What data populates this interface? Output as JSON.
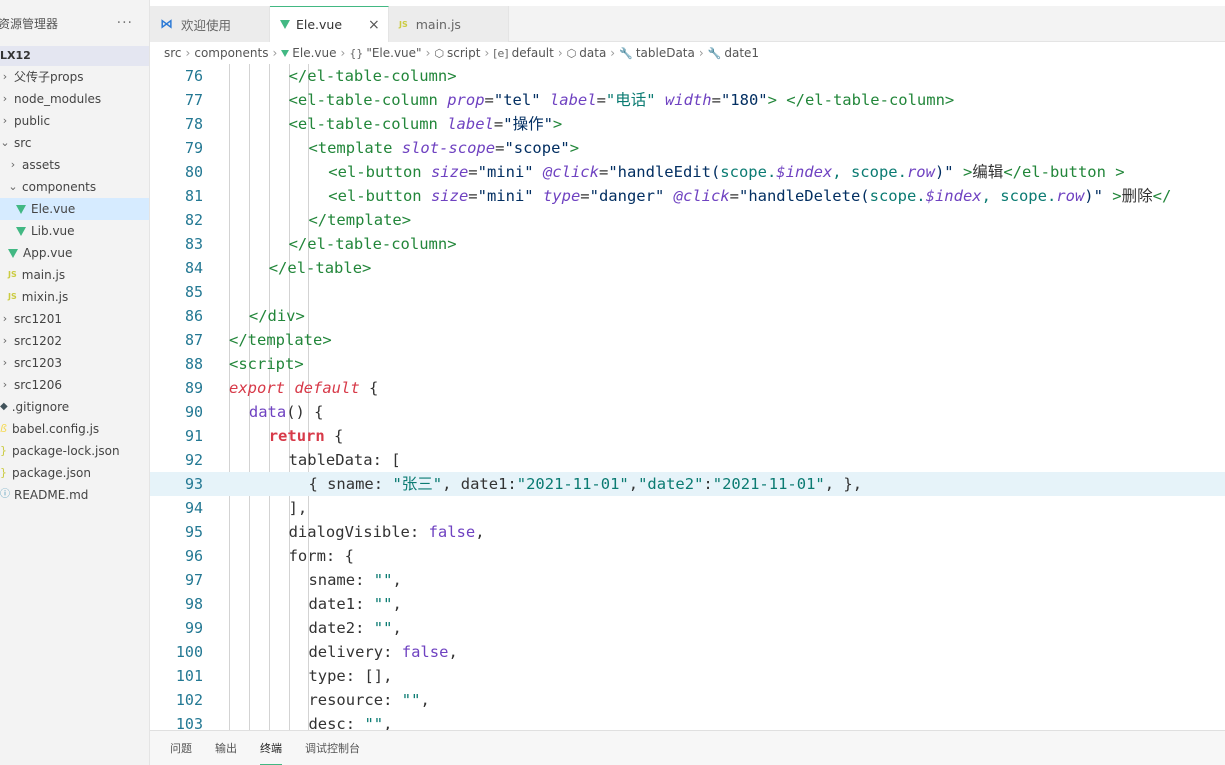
{
  "sidebar": {
    "title": "资源管理器",
    "more": "···",
    "project": "LX12",
    "items": [
      {
        "label": "父传子props",
        "chev": "›",
        "indent": 0,
        "icon": ""
      },
      {
        "label": "node_modules",
        "chev": "›",
        "indent": 0,
        "icon": ""
      },
      {
        "label": "public",
        "chev": "›",
        "indent": 0,
        "icon": ""
      },
      {
        "label": "src",
        "chev": "⌄",
        "indent": 0,
        "icon": ""
      },
      {
        "label": "assets",
        "chev": "›",
        "indent": 1,
        "icon": ""
      },
      {
        "label": "components",
        "chev": "⌄",
        "indent": 1,
        "icon": ""
      },
      {
        "label": "Ele.vue",
        "chev": "",
        "indent": 2,
        "icon": "vue"
      },
      {
        "label": "Lib.vue",
        "chev": "",
        "indent": 2,
        "icon": "vue"
      },
      {
        "label": "App.vue",
        "chev": "",
        "indent": 1,
        "icon": "vue"
      },
      {
        "label": "main.js",
        "chev": "",
        "indent": 1,
        "icon": "js"
      },
      {
        "label": "mixin.js",
        "chev": "",
        "indent": 1,
        "icon": "js"
      },
      {
        "label": "src1201",
        "chev": "›",
        "indent": 0,
        "icon": ""
      },
      {
        "label": "src1202",
        "chev": "›",
        "indent": 0,
        "icon": ""
      },
      {
        "label": "src1203",
        "chev": "›",
        "indent": 0,
        "icon": ""
      },
      {
        "label": "src1206",
        "chev": "›",
        "indent": 0,
        "icon": ""
      },
      {
        "label": ".gitignore",
        "chev": "",
        "indent": 0,
        "icon": "git"
      },
      {
        "label": "babel.config.js",
        "chev": "",
        "indent": 0,
        "icon": "babel"
      },
      {
        "label": "package-lock.json",
        "chev": "",
        "indent": 0,
        "icon": "json"
      },
      {
        "label": "package.json",
        "chev": "",
        "indent": 0,
        "icon": "json"
      },
      {
        "label": "README.md",
        "chev": "",
        "indent": 0,
        "icon": "info"
      }
    ]
  },
  "tabs": [
    {
      "label": "欢迎使用",
      "icon": "vscode-icon",
      "active": false
    },
    {
      "label": "Ele.vue",
      "icon": "vue-icon",
      "active": true,
      "close": "×"
    },
    {
      "label": "main.js",
      "icon": "js-icon",
      "active": false
    }
  ],
  "breadcrumb": [
    {
      "label": "src",
      "icon": ""
    },
    {
      "label": "components",
      "icon": ""
    },
    {
      "label": "Ele.vue",
      "icon": "vue"
    },
    {
      "label": "\"Ele.vue\"",
      "icon": "{}"
    },
    {
      "label": "script",
      "icon": "⬡"
    },
    {
      "label": "default",
      "icon": "[e]"
    },
    {
      "label": "data",
      "icon": "⬡"
    },
    {
      "label": "tableData",
      "icon": "🔧"
    },
    {
      "label": "date1",
      "icon": "🔧"
    }
  ],
  "editor": {
    "current_line": 93,
    "lines": [
      {
        "n": "76",
        "indent": 3,
        "parts": [
          [
            "tag",
            "</el-table-column>"
          ]
        ]
      },
      {
        "n": "77",
        "indent": 3,
        "parts": [
          [
            "tag",
            "<el-table-column "
          ],
          [
            "attr",
            "prop"
          ],
          [
            "punc",
            "="
          ],
          [
            "str",
            "\"tel\""
          ],
          [
            "punc",
            " "
          ],
          [
            "attr",
            "label"
          ],
          [
            "punc",
            "="
          ],
          [
            "str2",
            "\"电话\""
          ],
          [
            "punc",
            " "
          ],
          [
            "attr",
            "width"
          ],
          [
            "punc",
            "="
          ],
          [
            "str",
            "\"180\""
          ],
          [
            "tag",
            "> </el-table-column>"
          ]
        ]
      },
      {
        "n": "78",
        "indent": 3,
        "parts": [
          [
            "tag",
            "<el-table-column "
          ],
          [
            "attr",
            "label"
          ],
          [
            "punc",
            "="
          ],
          [
            "str",
            "\"操作\""
          ],
          [
            "tag",
            ">"
          ]
        ]
      },
      {
        "n": "79",
        "indent": 4,
        "parts": [
          [
            "tag",
            "<template "
          ],
          [
            "attr",
            "slot-scope"
          ],
          [
            "punc",
            "="
          ],
          [
            "str",
            "\"scope\""
          ],
          [
            "tag",
            ">"
          ]
        ]
      },
      {
        "n": "80",
        "indent": 5,
        "parts": [
          [
            "tag",
            "<el-button "
          ],
          [
            "attr",
            "size"
          ],
          [
            "punc",
            "="
          ],
          [
            "str",
            "\"mini\""
          ],
          [
            "punc",
            " "
          ],
          [
            "attr",
            "@click"
          ],
          [
            "punc",
            "="
          ],
          [
            "str",
            "\"handleEdit("
          ],
          [
            "str2",
            "scope."
          ],
          [
            "vattr",
            "$index"
          ],
          [
            "str2",
            ", scope."
          ],
          [
            "vattr",
            "row"
          ],
          [
            "str",
            ")\""
          ],
          [
            "tag",
            " >"
          ],
          [
            "punc",
            "编辑"
          ],
          [
            "tag",
            "</el-button >"
          ]
        ]
      },
      {
        "n": "81",
        "indent": 5,
        "parts": [
          [
            "tag",
            "<el-button "
          ],
          [
            "attr",
            "size"
          ],
          [
            "punc",
            "="
          ],
          [
            "str",
            "\"mini\""
          ],
          [
            "punc",
            " "
          ],
          [
            "attr",
            "type"
          ],
          [
            "punc",
            "="
          ],
          [
            "str",
            "\"danger\""
          ],
          [
            "punc",
            " "
          ],
          [
            "attr",
            "@click"
          ],
          [
            "punc",
            "="
          ],
          [
            "str",
            "\"handleDelete("
          ],
          [
            "str2",
            "scope."
          ],
          [
            "vattr",
            "$index"
          ],
          [
            "str2",
            ", scope."
          ],
          [
            "vattr",
            "row"
          ],
          [
            "str",
            ")\""
          ],
          [
            "tag",
            " >"
          ],
          [
            "punc",
            "删除"
          ],
          [
            "tag",
            "</"
          ]
        ]
      },
      {
        "n": "82",
        "indent": 4,
        "parts": [
          [
            "tag",
            "</template>"
          ]
        ]
      },
      {
        "n": "83",
        "indent": 3,
        "parts": [
          [
            "tag",
            "</el-table-column>"
          ]
        ]
      },
      {
        "n": "84",
        "indent": 2,
        "parts": [
          [
            "tag",
            "</el-table>"
          ]
        ]
      },
      {
        "n": "85",
        "indent": 0,
        "parts": []
      },
      {
        "n": "86",
        "indent": 1,
        "parts": [
          [
            "tag",
            "</div>"
          ]
        ]
      },
      {
        "n": "87",
        "indent": 0,
        "parts": [
          [
            "tag",
            "</template>"
          ]
        ]
      },
      {
        "n": "88",
        "indent": 0,
        "parts": [
          [
            "tag",
            "<script>"
          ]
        ]
      },
      {
        "n": "89",
        "indent": 0,
        "parts": [
          [
            "kw",
            "export default"
          ],
          [
            "punc",
            " {"
          ]
        ]
      },
      {
        "n": "90",
        "indent": 1,
        "parts": [
          [
            "fn",
            "data"
          ],
          [
            "punc",
            "() {"
          ]
        ]
      },
      {
        "n": "91",
        "indent": 2,
        "parts": [
          [
            "ret",
            "return"
          ],
          [
            "punc",
            " {"
          ]
        ]
      },
      {
        "n": "92",
        "indent": 3,
        "parts": [
          [
            "punc",
            "tableData: ["
          ]
        ]
      },
      {
        "n": "93",
        "indent": 4,
        "parts": [
          [
            "punc",
            "{ sname: "
          ],
          [
            "str2",
            "\"张三\""
          ],
          [
            "punc",
            ", date1:"
          ],
          [
            "str2",
            "\"2021-11-01\""
          ],
          [
            "punc",
            ","
          ],
          [
            "str2",
            "\"date2\""
          ],
          [
            "punc",
            ":"
          ],
          [
            "str2",
            "\"2021-11-01\""
          ],
          [
            "punc",
            ", },"
          ]
        ]
      },
      {
        "n": "94",
        "indent": 3,
        "parts": [
          [
            "punc",
            "],"
          ]
        ]
      },
      {
        "n": "95",
        "indent": 3,
        "parts": [
          [
            "punc",
            "dialogVisible: "
          ],
          [
            "bool",
            "false"
          ],
          [
            "punc",
            ","
          ]
        ]
      },
      {
        "n": "96",
        "indent": 3,
        "parts": [
          [
            "punc",
            "form: {"
          ]
        ]
      },
      {
        "n": "97",
        "indent": 4,
        "parts": [
          [
            "punc",
            "sname: "
          ],
          [
            "str2",
            "\"\""
          ],
          [
            "punc",
            ","
          ]
        ]
      },
      {
        "n": "98",
        "indent": 4,
        "parts": [
          [
            "punc",
            "date1: "
          ],
          [
            "str2",
            "\"\""
          ],
          [
            "punc",
            ","
          ]
        ]
      },
      {
        "n": "99",
        "indent": 4,
        "parts": [
          [
            "punc",
            "date2: "
          ],
          [
            "str2",
            "\"\""
          ],
          [
            "punc",
            ","
          ]
        ]
      },
      {
        "n": "100",
        "indent": 4,
        "parts": [
          [
            "punc",
            "delivery: "
          ],
          [
            "bool",
            "false"
          ],
          [
            "punc",
            ","
          ]
        ]
      },
      {
        "n": "101",
        "indent": 4,
        "parts": [
          [
            "punc",
            "type: [],"
          ]
        ]
      },
      {
        "n": "102",
        "indent": 4,
        "parts": [
          [
            "punc",
            "resource: "
          ],
          [
            "str2",
            "\"\""
          ],
          [
            "punc",
            ","
          ]
        ]
      },
      {
        "n": "103",
        "indent": 4,
        "parts": [
          [
            "punc",
            "desc: "
          ],
          [
            "str2",
            "\"\""
          ],
          [
            "punc",
            ","
          ]
        ]
      }
    ]
  },
  "panel": {
    "tabs": [
      {
        "label": "问题",
        "active": false
      },
      {
        "label": "输出",
        "active": false
      },
      {
        "label": "终端",
        "active": true
      },
      {
        "label": "调试控制台",
        "active": false
      }
    ]
  },
  "colors": {
    "accent": "#42b883",
    "selection": "#d6ebff",
    "current_line": "#e6f3f9",
    "line_number": "#237893"
  }
}
